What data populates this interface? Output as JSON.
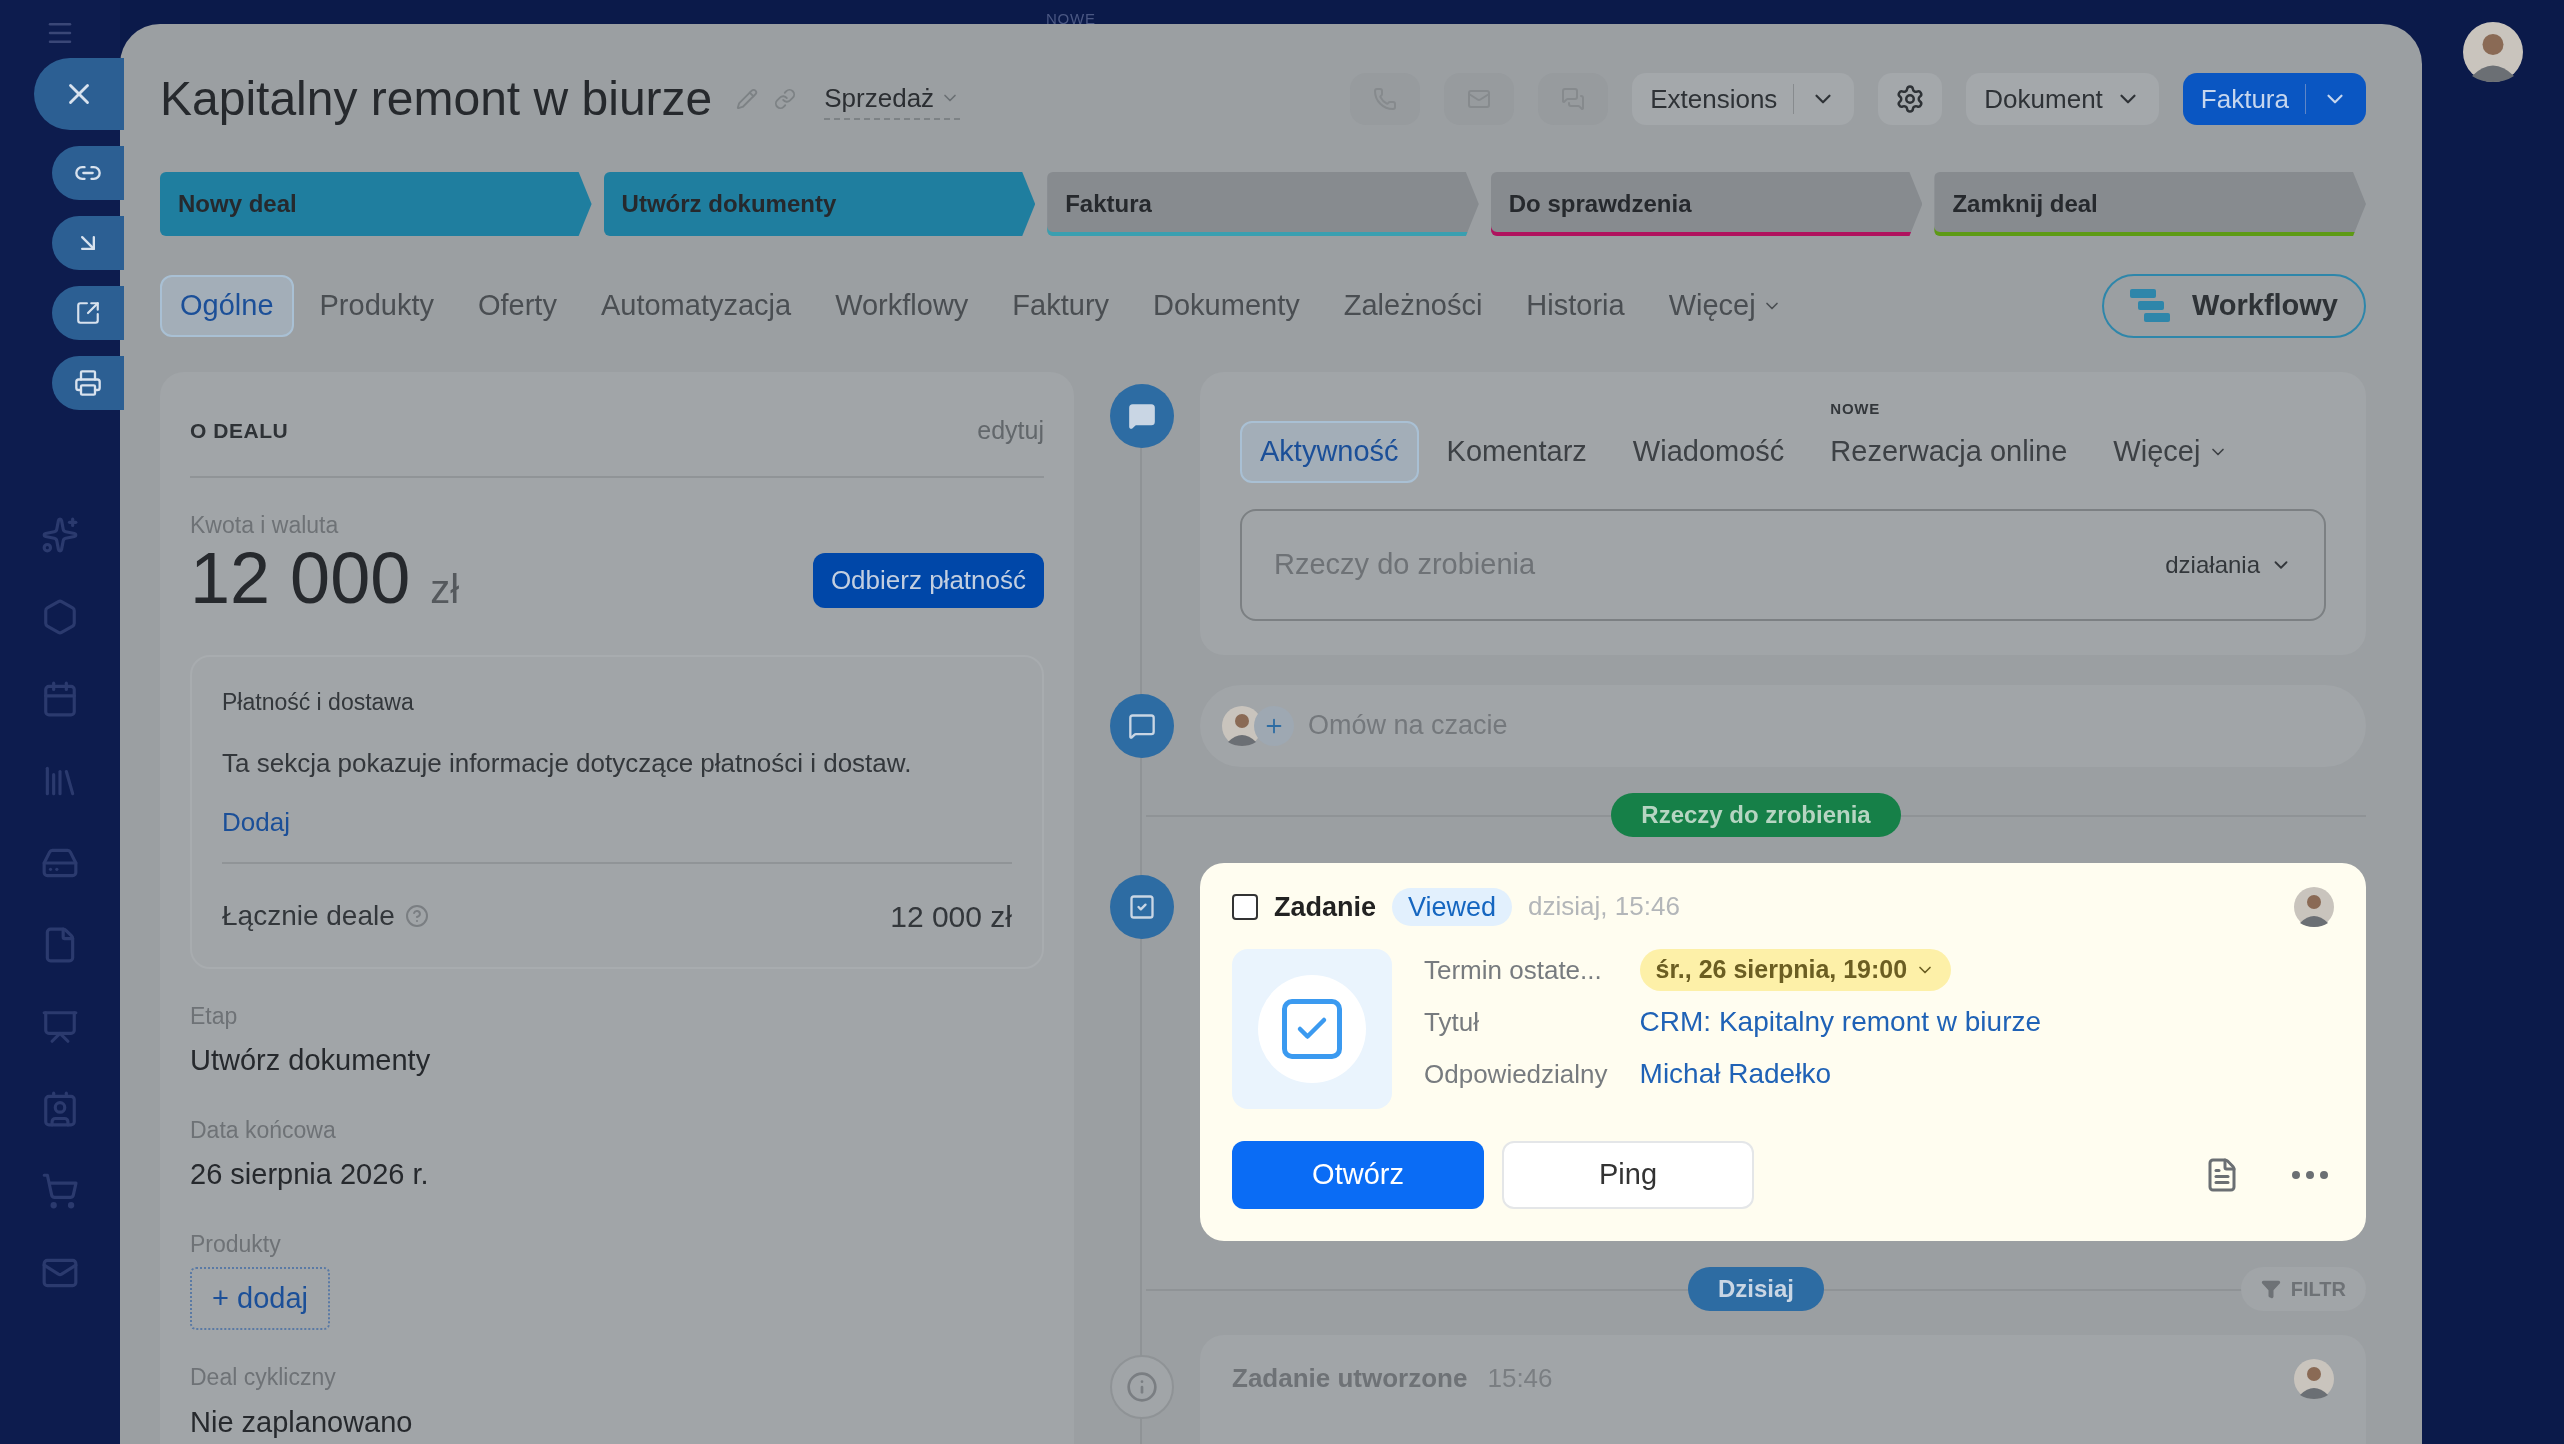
{
  "top_label": "NOWE",
  "header": {
    "title": "Kapitalny remont w biurze",
    "pipeline": "Sprzedaż",
    "buttons": [
      {
        "label": "Extensions",
        "kind": "split"
      },
      {
        "label": "Dokument",
        "kind": "dropdown"
      },
      {
        "label": "Faktura",
        "kind": "primary"
      }
    ]
  },
  "stages": [
    {
      "label": "Nowy deal",
      "selected": true,
      "color": "#1f7e9f"
    },
    {
      "label": "Utwórz dokumenty",
      "selected": true,
      "color": "#1f7e9f"
    },
    {
      "label": "Faktura",
      "selected": false,
      "color": "#3a9fb0"
    },
    {
      "label": "Do sprawdzenia",
      "selected": false,
      "color": "#b0125e"
    },
    {
      "label": "Zamknij deal",
      "selected": false,
      "color": "#5d9a14"
    }
  ],
  "tabs": [
    {
      "label": "Ogólne",
      "selected": true
    },
    {
      "label": "Produkty",
      "selected": false
    },
    {
      "label": "Oferty",
      "selected": false
    },
    {
      "label": "Automatyzacja",
      "selected": false
    },
    {
      "label": "Workflowy",
      "selected": false
    },
    {
      "label": "Faktury",
      "selected": false
    },
    {
      "label": "Dokumenty",
      "selected": false
    },
    {
      "label": "Zależności",
      "selected": false
    },
    {
      "label": "Historia",
      "selected": false
    },
    {
      "label": "Więcej",
      "selected": false
    }
  ],
  "workflow_button": "Workflowy",
  "deal": {
    "heading": "O DEALU",
    "edit": "edytuj",
    "amount_label": "Kwota i waluta",
    "amount": "12 000",
    "currency": "zł",
    "pay_button": "Odbierz płatność",
    "payment": {
      "title": "Płatność i dostawa",
      "text": "Ta sekcja pokazuje informacje dotyczące płatności i dostaw.",
      "add": "Dodaj",
      "total_label": "Łącznie deale",
      "total": "12 000 zł"
    },
    "fields": [
      {
        "label": "Etap",
        "value": "Utwórz dokumenty"
      },
      {
        "label": "Data końcowa",
        "value": "26 sierpnia 2026 r."
      }
    ],
    "products_label": "Produkty",
    "products_add": "+ dodaj",
    "recurring_label": "Deal cykliczny",
    "recurring": "Nie zaplanowano"
  },
  "activity": {
    "tabs": [
      {
        "label": "Aktywność",
        "selected": true
      },
      {
        "label": "Komentarz",
        "selected": false
      },
      {
        "label": "Wiadomość",
        "selected": false
      },
      {
        "label": "Rezerwacja online",
        "selected": false,
        "badge": "NOWE"
      },
      {
        "label": "Więcej",
        "selected": false
      }
    ],
    "placeholder": "Rzeczy do zrobienia",
    "action": "działania"
  },
  "chat": {
    "placeholder": "Omów na czacie"
  },
  "todo_label": "Rzeczy do zrobienia",
  "task": {
    "checked": false,
    "type": "Zadanie",
    "status": "Viewed",
    "time": "dzisiaj, 15:46",
    "fields": [
      {
        "label": "Termin ostate...",
        "value": "śr., 26 sierpnia, 19:00",
        "kind": "deadline"
      },
      {
        "label": "Tytuł",
        "value": "CRM: Kapitalny remont w biurze",
        "kind": "link"
      },
      {
        "label": "Odpowiedzialny",
        "value": "Michał Radełko",
        "kind": "person"
      }
    ],
    "open_button": "Otwórz",
    "ping_button": "Ping"
  },
  "today_label": "Dzisiaj",
  "filter": "FILTR",
  "history": {
    "title": "Zadanie utworzone",
    "time": "15:46"
  }
}
